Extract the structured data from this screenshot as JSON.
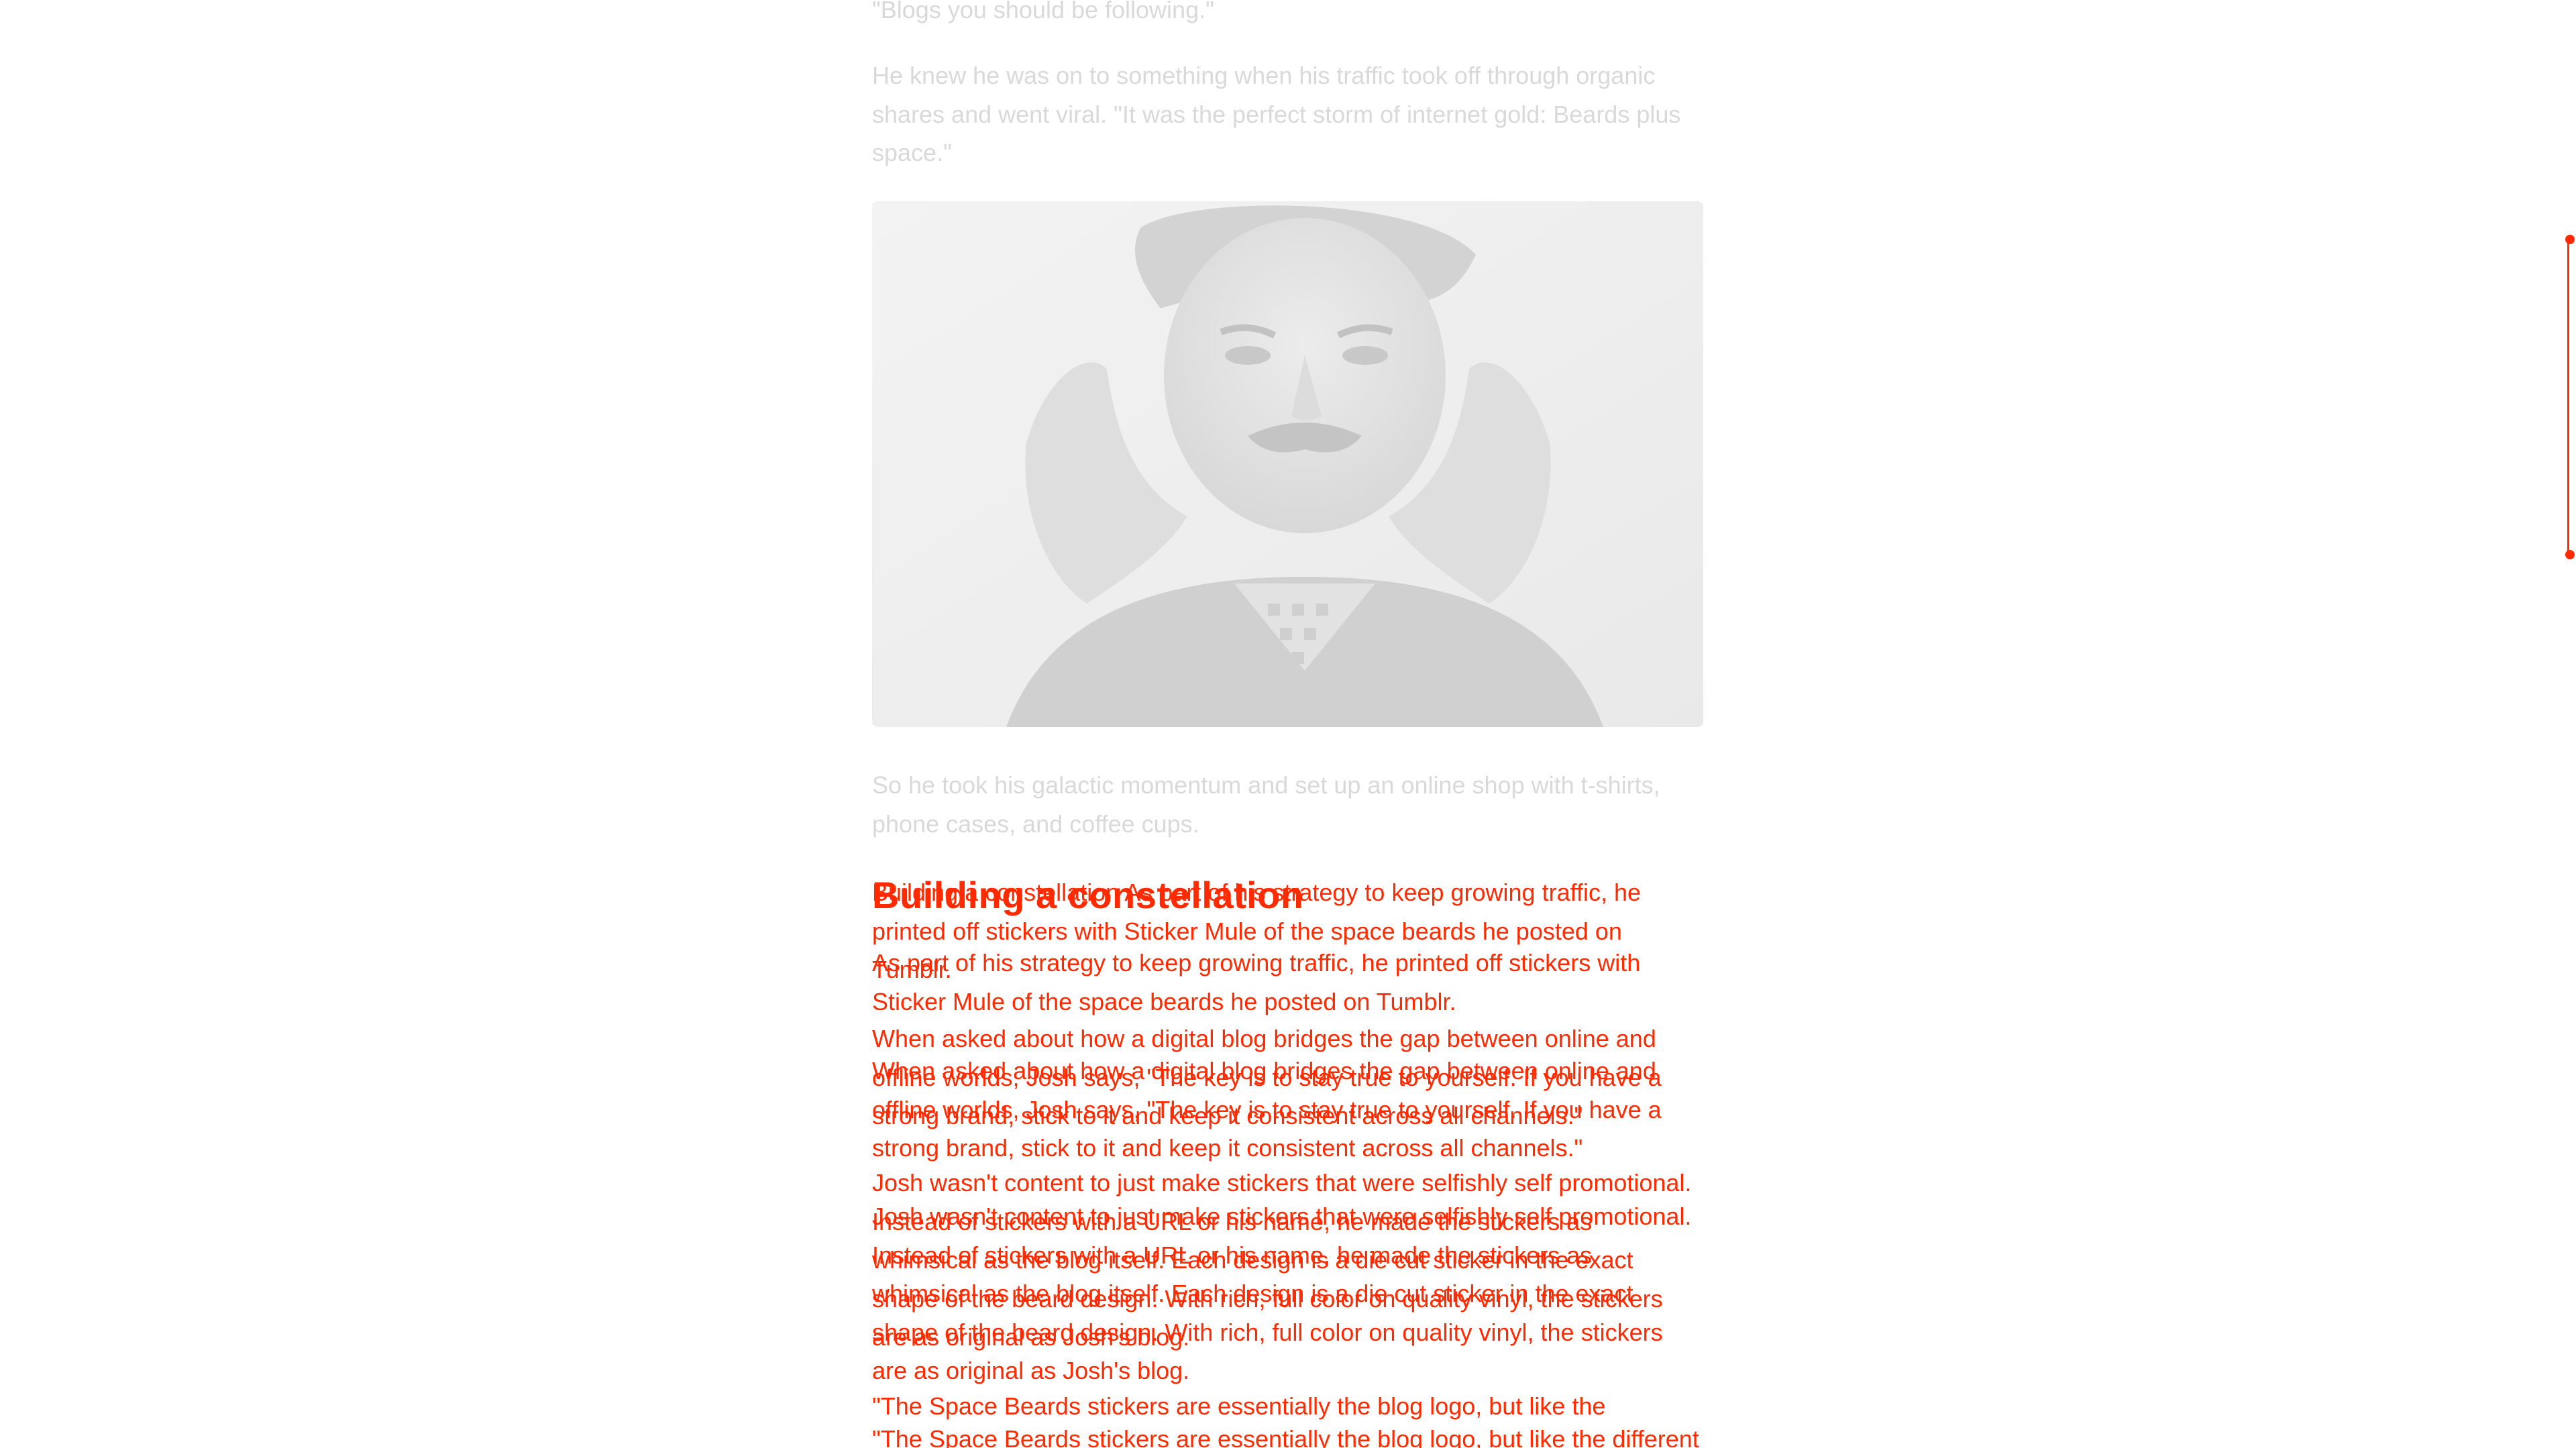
{
  "article": {
    "faded_top_quote": "\"Blogs you should be following.\"",
    "faded_para_1": "He knew he was on to something when his traffic took off through organic shares and went viral. \"It was the perfect storm of internet gold: Beards plus space.\"",
    "faded_para_2": "So he took his galactic momentum and set up an online shop with t-shirts, phone cases, and coffee cups.",
    "overlay_heading": "Building a constellation",
    "overlay_para_1_ghost": "Building a constellation As part of his strategy to keep growing traffic, he printed off stickers with Sticker Mule of the space beards he posted on Tumblr.",
    "overlay_para_1": "As part of his strategy to keep growing traffic, he printed off stickers with Sticker Mule of the space beards he posted on Tumblr.",
    "overlay_para_2_ghost": "When asked about how a digital blog bridges the gap between online and offline worlds, Josh says, \"The key is to stay true to yourself. If you have a strong brand, stick to it and keep it consistent across all channels.\"",
    "overlay_para_2": "When asked about how a digital blog bridges the gap between online and offline worlds, Josh says, \"The key is to stay true to yourself. If you have a strong brand, stick to it and keep it consistent across all channels.\"",
    "overlay_para_3_ghost": "Josh wasn't content to just make stickers that were selfishly self promotional. Instead of stickers with a URL or his name, he made the stickers as whimsical as the blog itself. Each design is a die cut sticker in the exact shape of the beard design. With rich, full color on quality vinyl, the stickers are as original as Josh's blog.",
    "overlay_para_3": "Josh wasn't content to just make stickers that were selfishly self promotional. Instead of stickers with a URL or his name, he made the stickers as whimsical as the blog itself. Each design is a die cut sticker in the exact shape of the beard design. With rich, full color on quality vinyl, the stickers are as original as Josh's blog.",
    "overlay_para_4_ghost": "\"The Space Beards stickers are essentially the blog logo, but like the different",
    "overlay_para_4": "\"The Space Beards stickers are essentially the blog logo, but like the"
  },
  "colors": {
    "accent": "#ff2a00",
    "faded_text": "#d9d9d9"
  },
  "icons": {
    "scrollbar": "scrollbar-thumb"
  }
}
